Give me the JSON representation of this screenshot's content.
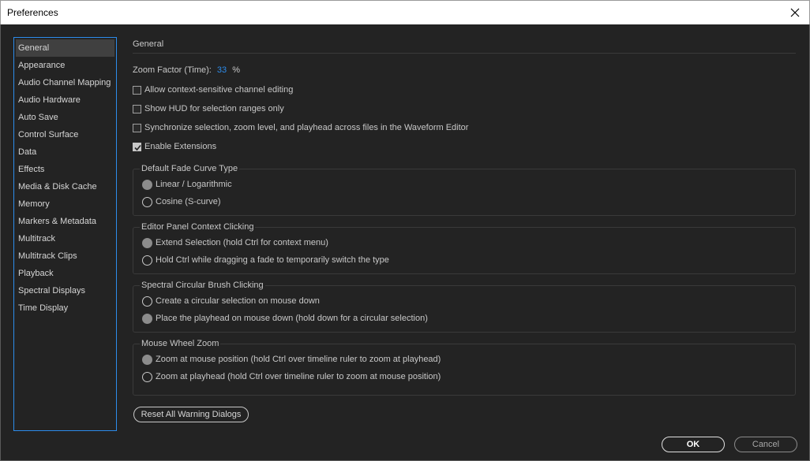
{
  "window": {
    "title": "Preferences"
  },
  "sidebar": {
    "items": [
      {
        "label": "General"
      },
      {
        "label": "Appearance"
      },
      {
        "label": "Audio Channel Mapping"
      },
      {
        "label": "Audio Hardware"
      },
      {
        "label": "Auto Save"
      },
      {
        "label": "Control Surface"
      },
      {
        "label": "Data"
      },
      {
        "label": "Effects"
      },
      {
        "label": "Media & Disk Cache"
      },
      {
        "label": "Memory"
      },
      {
        "label": "Markers & Metadata"
      },
      {
        "label": "Multitrack"
      },
      {
        "label": "Multitrack Clips"
      },
      {
        "label": "Playback"
      },
      {
        "label": "Spectral Displays"
      },
      {
        "label": "Time Display"
      }
    ],
    "selected": "General"
  },
  "general": {
    "section_title": "General",
    "zoom_label": "Zoom Factor (Time):",
    "zoom_value": "33",
    "zoom_unit": "%",
    "checkboxes": [
      {
        "label": "Allow context-sensitive channel editing",
        "checked": false
      },
      {
        "label": "Show HUD for selection ranges only",
        "checked": false
      },
      {
        "label": "Synchronize selection, zoom level, and playhead across files in the Waveform Editor",
        "checked": false
      },
      {
        "label": "Enable Extensions",
        "checked": true
      }
    ],
    "groups": [
      {
        "title": "Default Fade Curve Type",
        "options": [
          {
            "label": "Linear / Logarithmic",
            "selected": true
          },
          {
            "label": "Cosine (S-curve)",
            "selected": false
          }
        ]
      },
      {
        "title": "Editor Panel Context Clicking",
        "options": [
          {
            "label": "Extend Selection (hold Ctrl for context menu)",
            "selected": true
          },
          {
            "label": "Hold Ctrl while dragging a fade to temporarily switch the type",
            "selected": false
          }
        ]
      },
      {
        "title": "Spectral Circular Brush Clicking",
        "options": [
          {
            "label": "Create a circular selection on mouse down",
            "selected": false
          },
          {
            "label": "Place the playhead on mouse down (hold down for a circular selection)",
            "selected": true
          }
        ]
      },
      {
        "title": "Mouse Wheel Zoom",
        "options": [
          {
            "label": "Zoom at mouse position (hold Ctrl over timeline ruler to zoom at playhead)",
            "selected": true
          },
          {
            "label": "Zoom at playhead (hold Ctrl over timeline ruler to zoom at mouse position)",
            "selected": false
          }
        ]
      }
    ],
    "reset_label": "Reset All Warning Dialogs"
  },
  "footer": {
    "ok_label": "OK",
    "cancel_label": "Cancel"
  },
  "colors": {
    "accent": "#2d8ceb",
    "background": "#232323",
    "text": "#c8c8c8"
  }
}
